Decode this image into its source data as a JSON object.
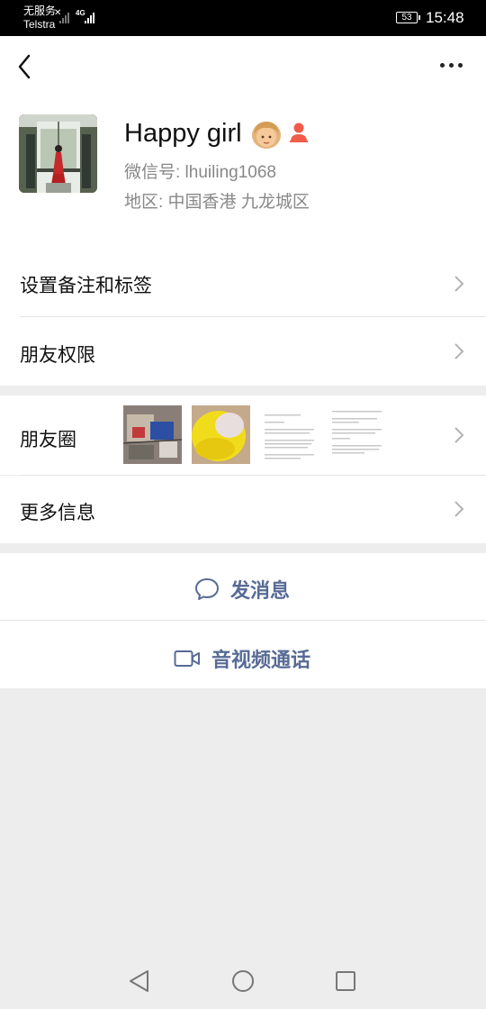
{
  "status_bar": {
    "carrier_line1": "无服务",
    "carrier_line2": "Telstra",
    "network": "4G",
    "battery": "53",
    "time": "15:48"
  },
  "header": {
    "back_icon": "chevron-left-icon",
    "more_icon": "more-dots-icon"
  },
  "profile": {
    "name": "Happy girl",
    "wechat_id": "微信号: lhuiling1068",
    "region": "地区: 中国香港  九龙城区"
  },
  "menu": {
    "remark_tags": "设置备注和标签",
    "friend_permissions": "朋友权限",
    "moments": "朋友圈",
    "more_info": "更多信息"
  },
  "actions": {
    "send_message": "发消息",
    "video_call": "音视频通话"
  },
  "colors": {
    "link_blue": "#576b95",
    "background": "#ededed"
  }
}
